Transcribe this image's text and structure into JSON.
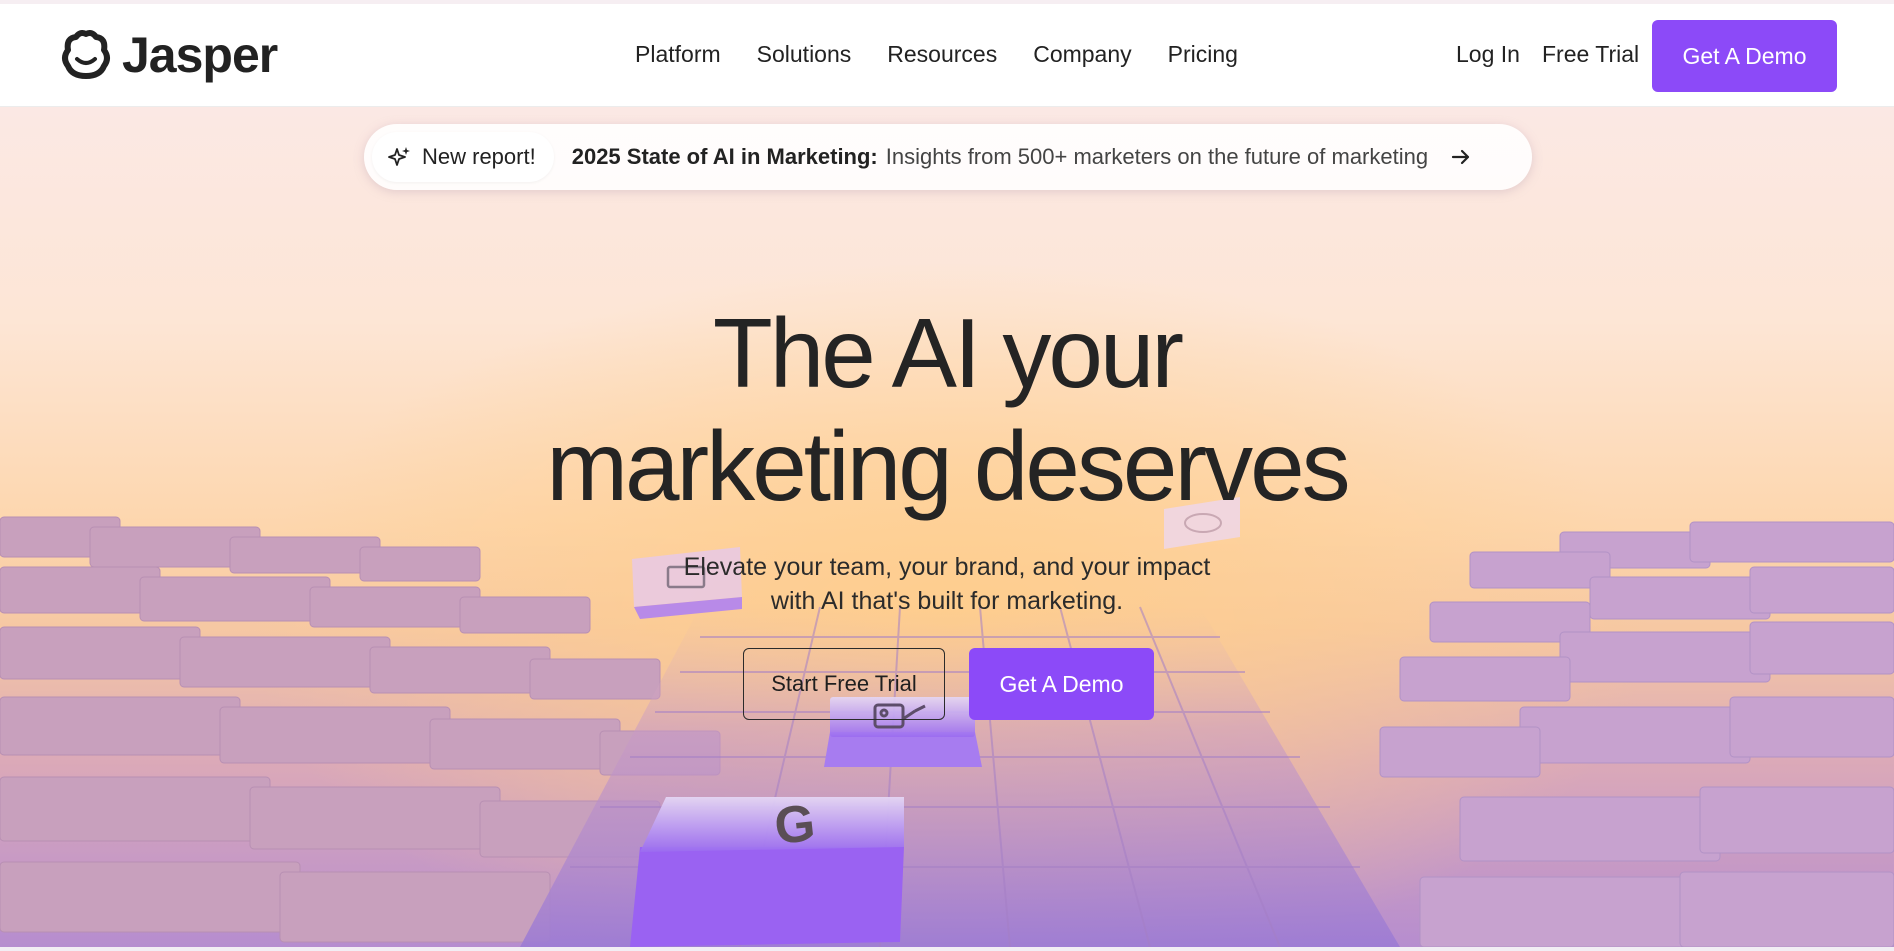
{
  "header": {
    "logo_text": "Jasper",
    "nav": [
      "Platform",
      "Solutions",
      "Resources",
      "Company",
      "Pricing"
    ],
    "login_label": "Log In",
    "free_trial_label": "Free Trial",
    "demo_label": "Get A Demo"
  },
  "banner": {
    "badge": "New report!",
    "title": "2025 State of AI in Marketing:",
    "description": "Insights from 500+ marketers on the future of marketing"
  },
  "hero": {
    "headline_line1": "The AI your",
    "headline_line2": "marketing deserves",
    "subtext_line1": "Elevate your team, your brand, and your impact",
    "subtext_line2": "with AI that's built for marketing.",
    "cta_secondary": "Start Free Trial",
    "cta_primary": "Get A Demo"
  },
  "colors": {
    "accent": "#8c4af8",
    "text": "#222222"
  },
  "icons": [
    "jasper-logo-icon",
    "sparkle-icon",
    "arrow-right-icon",
    "google-icon",
    "image-edit-icon",
    "salesforce-icon"
  ]
}
